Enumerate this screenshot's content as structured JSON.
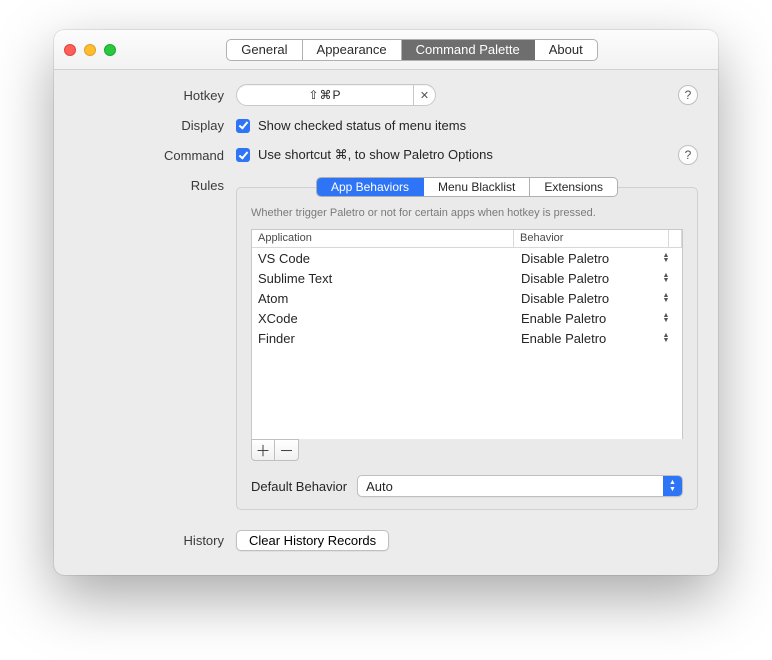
{
  "tabs": {
    "general": "General",
    "appearance": "Appearance",
    "command_palette": "Command Palette",
    "about": "About"
  },
  "labels": {
    "hotkey": "Hotkey",
    "display": "Display",
    "command": "Command",
    "rules": "Rules",
    "history": "History",
    "default_behavior": "Default Behavior"
  },
  "hotkey": {
    "value": "⇧⌘P"
  },
  "display_checkbox": {
    "label": "Show checked status of menu items"
  },
  "command_checkbox": {
    "label": "Use shortcut ⌘, to show Paletro Options"
  },
  "rules_tabs": {
    "app": "App Behaviors",
    "blacklist": "Menu Blacklist",
    "ext": "Extensions"
  },
  "rules_desc": "Whether trigger Paletro or not for certain apps when hotkey is pressed.",
  "table": {
    "head_app": "Application",
    "head_beh": "Behavior",
    "rows": [
      {
        "app": "VS Code",
        "beh": "Disable Paletro"
      },
      {
        "app": "Sublime Text",
        "beh": "Disable Paletro"
      },
      {
        "app": "Atom",
        "beh": "Disable Paletro"
      },
      {
        "app": "XCode",
        "beh": "Enable Paletro"
      },
      {
        "app": "Finder",
        "beh": "Enable Paletro"
      }
    ]
  },
  "default_select": {
    "value": "Auto"
  },
  "history_button": "Clear History Records"
}
